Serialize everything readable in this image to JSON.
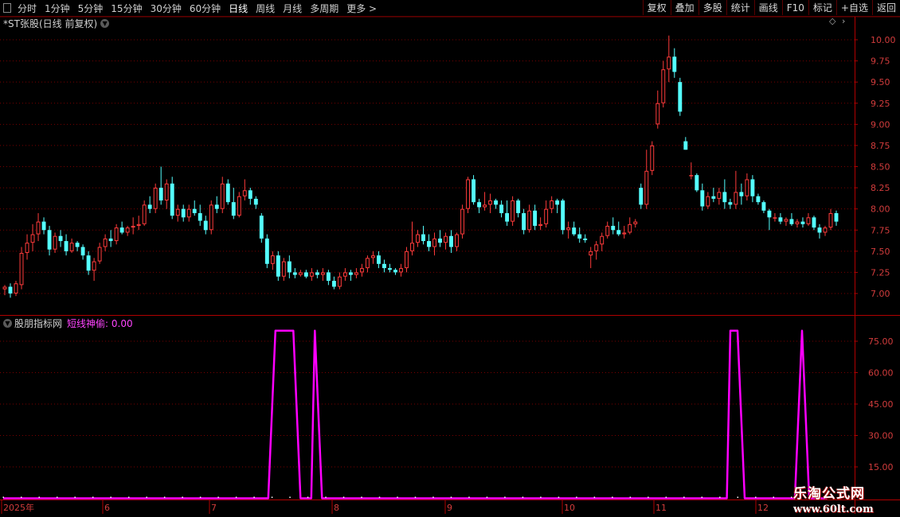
{
  "toolbar": {
    "periods": [
      "分时",
      "1分钟",
      "5分钟",
      "15分钟",
      "30分钟",
      "60分钟",
      "日线",
      "周线",
      "月线",
      "多周期",
      "更多 >"
    ],
    "active_period": "日线",
    "right_buttons": [
      "复权",
      "叠加",
      "多股",
      "统计",
      "画线",
      "F10",
      "标记",
      "+自选",
      "返回"
    ]
  },
  "price_panel": {
    "title": "*ST张股(日线 前复权)",
    "y_ticks": [
      "10.00",
      "9.75",
      "9.50",
      "9.25",
      "9.00",
      "8.75",
      "8.50",
      "8.25",
      "8.00",
      "7.75",
      "7.50",
      "7.25",
      "7.00"
    ]
  },
  "indicator_panel": {
    "name": "股朋指标网",
    "series_label": "短线神偷: 0.00",
    "y_ticks": [
      "75.00",
      "60.00",
      "45.00",
      "30.00",
      "15.00"
    ]
  },
  "x_axis": {
    "labels": [
      "2025年",
      "6",
      "7",
      "8",
      "9",
      "10",
      "11",
      "12"
    ]
  },
  "watermark": {
    "line1": "乐淘公式网",
    "line2": "www.60lt.com"
  },
  "colors": {
    "background": "#000000",
    "up_candle": "#ff3b3b",
    "down_candle": "#54ffff",
    "indicator_line": "#ff00ff",
    "grid": "#7a0000",
    "axis": "#b00000",
    "tick_text": "#d23c3c"
  },
  "chart_data": [
    {
      "type": "candlestick",
      "title": "*ST张股(日线 前复权)",
      "ylim": [
        6.9,
        10.1
      ],
      "grid": true,
      "candles_ohlc": [
        [
          7.05,
          7.1,
          6.98,
          7.08
        ],
        [
          7.08,
          7.12,
          6.95,
          7.0
        ],
        [
          7.0,
          7.15,
          6.97,
          7.12
        ],
        [
          7.1,
          7.55,
          7.05,
          7.48
        ],
        [
          7.48,
          7.7,
          7.4,
          7.6
        ],
        [
          7.6,
          7.82,
          7.5,
          7.7
        ],
        [
          7.7,
          7.95,
          7.62,
          7.85
        ],
        [
          7.85,
          7.9,
          7.7,
          7.75
        ],
        [
          7.75,
          7.8,
          7.45,
          7.52
        ],
        [
          7.52,
          7.72,
          7.48,
          7.68
        ],
        [
          7.68,
          7.75,
          7.55,
          7.62
        ],
        [
          7.62,
          7.7,
          7.45,
          7.5
        ],
        [
          7.5,
          7.65,
          7.48,
          7.6
        ],
        [
          7.6,
          7.62,
          7.5,
          7.55
        ],
        [
          7.55,
          7.58,
          7.4,
          7.45
        ],
        [
          7.45,
          7.5,
          7.22,
          7.27
        ],
        [
          7.27,
          7.42,
          7.15,
          7.38
        ],
        [
          7.38,
          7.6,
          7.35,
          7.55
        ],
        [
          7.55,
          7.7,
          7.5,
          7.65
        ],
        [
          7.65,
          7.75,
          7.55,
          7.62
        ],
        [
          7.62,
          7.82,
          7.58,
          7.78
        ],
        [
          7.78,
          7.85,
          7.7,
          7.72
        ],
        [
          7.72,
          7.8,
          7.68,
          7.78
        ],
        [
          7.78,
          7.9,
          7.7,
          7.8
        ],
        [
          7.8,
          7.92,
          7.75,
          7.82
        ],
        [
          7.82,
          8.1,
          7.8,
          8.05
        ],
        [
          8.05,
          8.15,
          7.95,
          8.0
        ],
        [
          8.0,
          8.3,
          7.95,
          8.25
        ],
        [
          8.25,
          8.5,
          8.05,
          8.1
        ],
        [
          8.1,
          8.35,
          8.0,
          8.3
        ],
        [
          8.3,
          8.38,
          7.88,
          7.92
        ],
        [
          7.92,
          8.05,
          7.85,
          8.0
        ],
        [
          8.0,
          8.05,
          7.85,
          7.9
        ],
        [
          7.9,
          8.05,
          7.85,
          8.0
        ],
        [
          8.0,
          8.1,
          7.92,
          7.95
        ],
        [
          7.95,
          8.05,
          7.8,
          7.86
        ],
        [
          7.86,
          7.92,
          7.7,
          7.75
        ],
        [
          7.75,
          8.1,
          7.7,
          8.05
        ],
        [
          8.05,
          8.15,
          7.95,
          8.0
        ],
        [
          8.0,
          8.38,
          7.95,
          8.3
        ],
        [
          8.3,
          8.35,
          8.05,
          8.08
        ],
        [
          8.08,
          8.25,
          7.88,
          7.92
        ],
        [
          7.92,
          8.2,
          7.9,
          8.15
        ],
        [
          8.15,
          8.35,
          8.1,
          8.22
        ],
        [
          8.22,
          8.25,
          8.05,
          8.12
        ],
        [
          8.12,
          8.15,
          8.0,
          8.05
        ],
        [
          7.92,
          7.95,
          7.6,
          7.65
        ],
        [
          7.65,
          7.7,
          7.3,
          7.35
        ],
        [
          7.35,
          7.5,
          7.28,
          7.45
        ],
        [
          7.45,
          7.5,
          7.15,
          7.2
        ],
        [
          7.2,
          7.42,
          7.15,
          7.38
        ],
        [
          7.38,
          7.45,
          7.18,
          7.25
        ],
        [
          7.25,
          7.3,
          7.18,
          7.22
        ],
        [
          7.22,
          7.28,
          7.2,
          7.25
        ],
        [
          7.25,
          7.28,
          7.18,
          7.2
        ],
        [
          7.2,
          7.3,
          7.15,
          7.25
        ],
        [
          7.25,
          7.28,
          7.18,
          7.22
        ],
        [
          7.22,
          7.3,
          7.15,
          7.25
        ],
        [
          7.25,
          7.28,
          7.1,
          7.15
        ],
        [
          7.15,
          7.2,
          7.05,
          7.08
        ],
        [
          7.08,
          7.25,
          7.05,
          7.2
        ],
        [
          7.2,
          7.3,
          7.15,
          7.25
        ],
        [
          7.25,
          7.28,
          7.15,
          7.22
        ],
        [
          7.22,
          7.3,
          7.18,
          7.25
        ],
        [
          7.25,
          7.35,
          7.2,
          7.3
        ],
        [
          7.3,
          7.45,
          7.25,
          7.42
        ],
        [
          7.42,
          7.5,
          7.35,
          7.45
        ],
        [
          7.45,
          7.5,
          7.3,
          7.35
        ],
        [
          7.35,
          7.4,
          7.25,
          7.3
        ],
        [
          7.3,
          7.35,
          7.25,
          7.28
        ],
        [
          7.28,
          7.3,
          7.22,
          7.25
        ],
        [
          7.25,
          7.35,
          7.2,
          7.3
        ],
        [
          7.3,
          7.55,
          7.25,
          7.5
        ],
        [
          7.5,
          7.85,
          7.45,
          7.6
        ],
        [
          7.6,
          7.75,
          7.55,
          7.7
        ],
        [
          7.7,
          7.8,
          7.58,
          7.62
        ],
        [
          7.62,
          7.7,
          7.5,
          7.55
        ],
        [
          7.55,
          7.72,
          7.45,
          7.65
        ],
        [
          7.65,
          7.75,
          7.55,
          7.6
        ],
        [
          7.6,
          7.72,
          7.52,
          7.68
        ],
        [
          7.68,
          7.75,
          7.48,
          7.55
        ],
        [
          7.55,
          7.72,
          7.5,
          7.7
        ],
        [
          7.7,
          8.05,
          7.65,
          8.0
        ],
        [
          8.0,
          8.38,
          7.95,
          8.35
        ],
        [
          8.35,
          8.4,
          8.05,
          8.08
        ],
        [
          8.08,
          8.12,
          7.95,
          8.02
        ],
        [
          8.02,
          8.2,
          7.98,
          8.05
        ],
        [
          8.05,
          8.18,
          7.95,
          8.1
        ],
        [
          8.1,
          8.12,
          8.0,
          8.05
        ],
        [
          8.05,
          8.1,
          7.9,
          7.95
        ],
        [
          7.95,
          8.1,
          7.8,
          7.85
        ],
        [
          7.85,
          8.15,
          7.8,
          8.1
        ],
        [
          8.1,
          8.12,
          7.9,
          7.95
        ],
        [
          7.95,
          8.0,
          7.7,
          7.75
        ],
        [
          7.75,
          8.05,
          7.72,
          7.98
        ],
        [
          7.98,
          8.05,
          7.75,
          7.8
        ],
        [
          7.8,
          7.9,
          7.75,
          7.82
        ],
        [
          7.82,
          8.1,
          7.78,
          8.0
        ],
        [
          8.0,
          8.15,
          7.95,
          8.1
        ],
        [
          8.1,
          8.12,
          7.95,
          8.05
        ],
        [
          8.1,
          8.12,
          7.7,
          7.75
        ],
        [
          7.75,
          7.85,
          7.65,
          7.78
        ],
        [
          7.78,
          7.85,
          7.68,
          7.7
        ],
        [
          7.7,
          7.78,
          7.6,
          7.65
        ],
        [
          7.65,
          7.7,
          7.6,
          7.63
        ],
        [
          7.45,
          7.55,
          7.3,
          7.5
        ],
        [
          7.5,
          7.62,
          7.4,
          7.58
        ],
        [
          7.58,
          7.72,
          7.5,
          7.68
        ],
        [
          7.68,
          7.85,
          7.65,
          7.8
        ],
        [
          7.8,
          7.9,
          7.7,
          7.75
        ],
        [
          7.75,
          7.85,
          7.68,
          7.7
        ],
        [
          7.7,
          7.8,
          7.65,
          7.72
        ],
        [
          7.72,
          7.9,
          7.7,
          7.82
        ],
        [
          7.82,
          7.88,
          7.78,
          7.85
        ],
        [
          8.25,
          8.3,
          8.0,
          8.05
        ],
        [
          8.05,
          8.7,
          8.0,
          8.45
        ],
        [
          8.45,
          8.8,
          8.4,
          8.75
        ],
        [
          9.0,
          9.4,
          8.95,
          9.25
        ],
        [
          9.25,
          9.75,
          9.2,
          9.65
        ],
        [
          9.65,
          10.05,
          9.5,
          9.8
        ],
        [
          9.8,
          9.9,
          9.55,
          9.62
        ],
        [
          9.5,
          9.55,
          9.1,
          9.15
        ],
        [
          8.8,
          8.85,
          8.7,
          8.7
        ],
        [
          8.4,
          8.55,
          8.35,
          8.4
        ],
        [
          8.4,
          8.42,
          8.2,
          8.22
        ],
        [
          8.22,
          8.3,
          7.98,
          8.03
        ],
        [
          8.03,
          8.2,
          8.0,
          8.15
        ],
        [
          8.15,
          8.25,
          8.08,
          8.12
        ],
        [
          8.12,
          8.25,
          8.05,
          8.2
        ],
        [
          8.2,
          8.35,
          8.0,
          8.08
        ],
        [
          8.08,
          8.12,
          8.0,
          8.05
        ],
        [
          8.05,
          8.45,
          8.0,
          8.2
        ],
        [
          8.2,
          8.3,
          8.05,
          8.15
        ],
        [
          8.15,
          8.42,
          8.1,
          8.35
        ],
        [
          8.35,
          8.4,
          8.08,
          8.15
        ],
        [
          8.15,
          8.18,
          8.05,
          8.08
        ],
        [
          8.08,
          8.1,
          7.95,
          7.98
        ],
        [
          7.98,
          8.0,
          7.75,
          7.9
        ],
        [
          7.9,
          7.95,
          7.85,
          7.9
        ],
        [
          7.9,
          7.95,
          7.82,
          7.85
        ],
        [
          7.85,
          7.9,
          7.8,
          7.88
        ],
        [
          7.88,
          7.95,
          7.8,
          7.82
        ],
        [
          7.82,
          7.88,
          7.78,
          7.85
        ],
        [
          7.85,
          7.9,
          7.78,
          7.82
        ],
        [
          7.82,
          7.95,
          7.8,
          7.9
        ],
        [
          7.9,
          7.92,
          7.75,
          7.78
        ],
        [
          7.78,
          7.82,
          7.65,
          7.72
        ],
        [
          7.72,
          7.8,
          7.68,
          7.78
        ],
        [
          7.78,
          8.0,
          7.75,
          7.95
        ],
        [
          7.95,
          7.98,
          7.8,
          7.85
        ]
      ]
    },
    {
      "type": "line",
      "series": [
        {
          "name": "短线神偷",
          "x_index_values": [
            [
              0,
              0
            ],
            [
              74,
              0
            ],
            [
              76,
              80
            ],
            [
              81,
              80
            ],
            [
              83,
              0
            ],
            [
              86,
              0
            ],
            [
              87,
              80
            ],
            [
              89,
              0
            ],
            [
              202,
              0
            ],
            [
              203,
              80
            ],
            [
              205,
              80
            ],
            [
              207,
              0
            ],
            [
              221,
              0
            ],
            [
              223,
              80
            ],
            [
              225,
              0
            ],
            [
              230,
              0
            ]
          ]
        }
      ],
      "ylim": [
        0,
        85
      ],
      "current_value": 0.0
    }
  ]
}
